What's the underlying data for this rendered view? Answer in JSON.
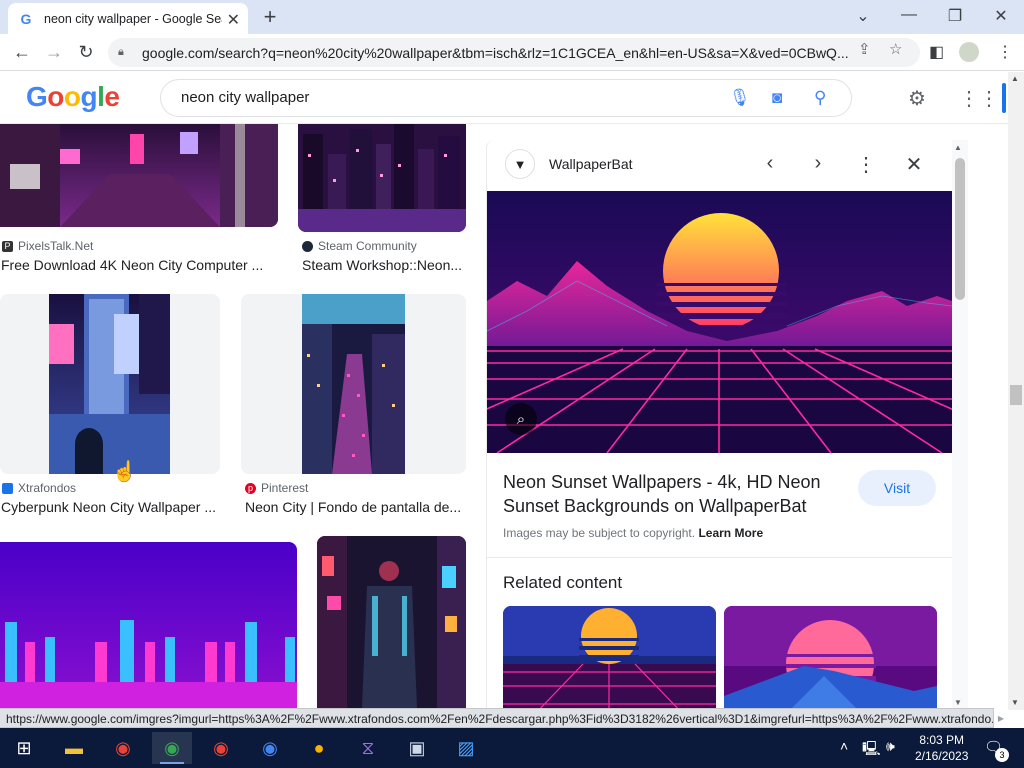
{
  "browser": {
    "tab_title": "neon city wallpaper - Google Search",
    "tab_favicon": "G",
    "url": "google.com/search?q=neon%20city%20wallpaper&tbm=isch&rlz=1C1GCEA_en&hl=en-US&sa=X&ved=0CBwQ..."
  },
  "google": {
    "logo": [
      "G",
      "o",
      "o",
      "g",
      "l",
      "e"
    ],
    "query": "neon city wallpaper"
  },
  "results": [
    {
      "source": "PixelsTalk.Net",
      "title": "Free Download 4K Neon City Computer ..."
    },
    {
      "source": "Steam Community",
      "title": "Steam Workshop::Neon..."
    },
    {
      "source": "Xtrafondos",
      "title": "Cyberpunk Neon City Wallpaper ..."
    },
    {
      "source": "Pinterest",
      "title": "Neon City | Fondo de pantalla de..."
    }
  ],
  "panel": {
    "site": "WallpaperBat",
    "title": "Neon Sunset Wallpapers - 4k, HD Neon Sunset Backgrounds on WallpaperBat",
    "visit_label": "Visit",
    "copyright_text": "Images may be subject to copyright.",
    "learn_more": "Learn More",
    "related_heading": "Related content"
  },
  "status_url": "https://www.google.com/imgres?imgurl=https%3A%2F%2Fwww.xtrafondos.com%2Fen%2Fdescargar.php%3Fid%3D3182%26vertical%3D1&imgrefurl=https%3A%2F%2Fwww.xtrafondo...",
  "taskbar": {
    "time": "8:03 PM",
    "date": "2/16/2023",
    "notification_count": "3"
  },
  "colors": {
    "accent": "#1a73e8",
    "neon_pink": "#ff2aa0",
    "neon_purple": "#7b2fbf",
    "sun_yellow": "#ffd23a"
  }
}
